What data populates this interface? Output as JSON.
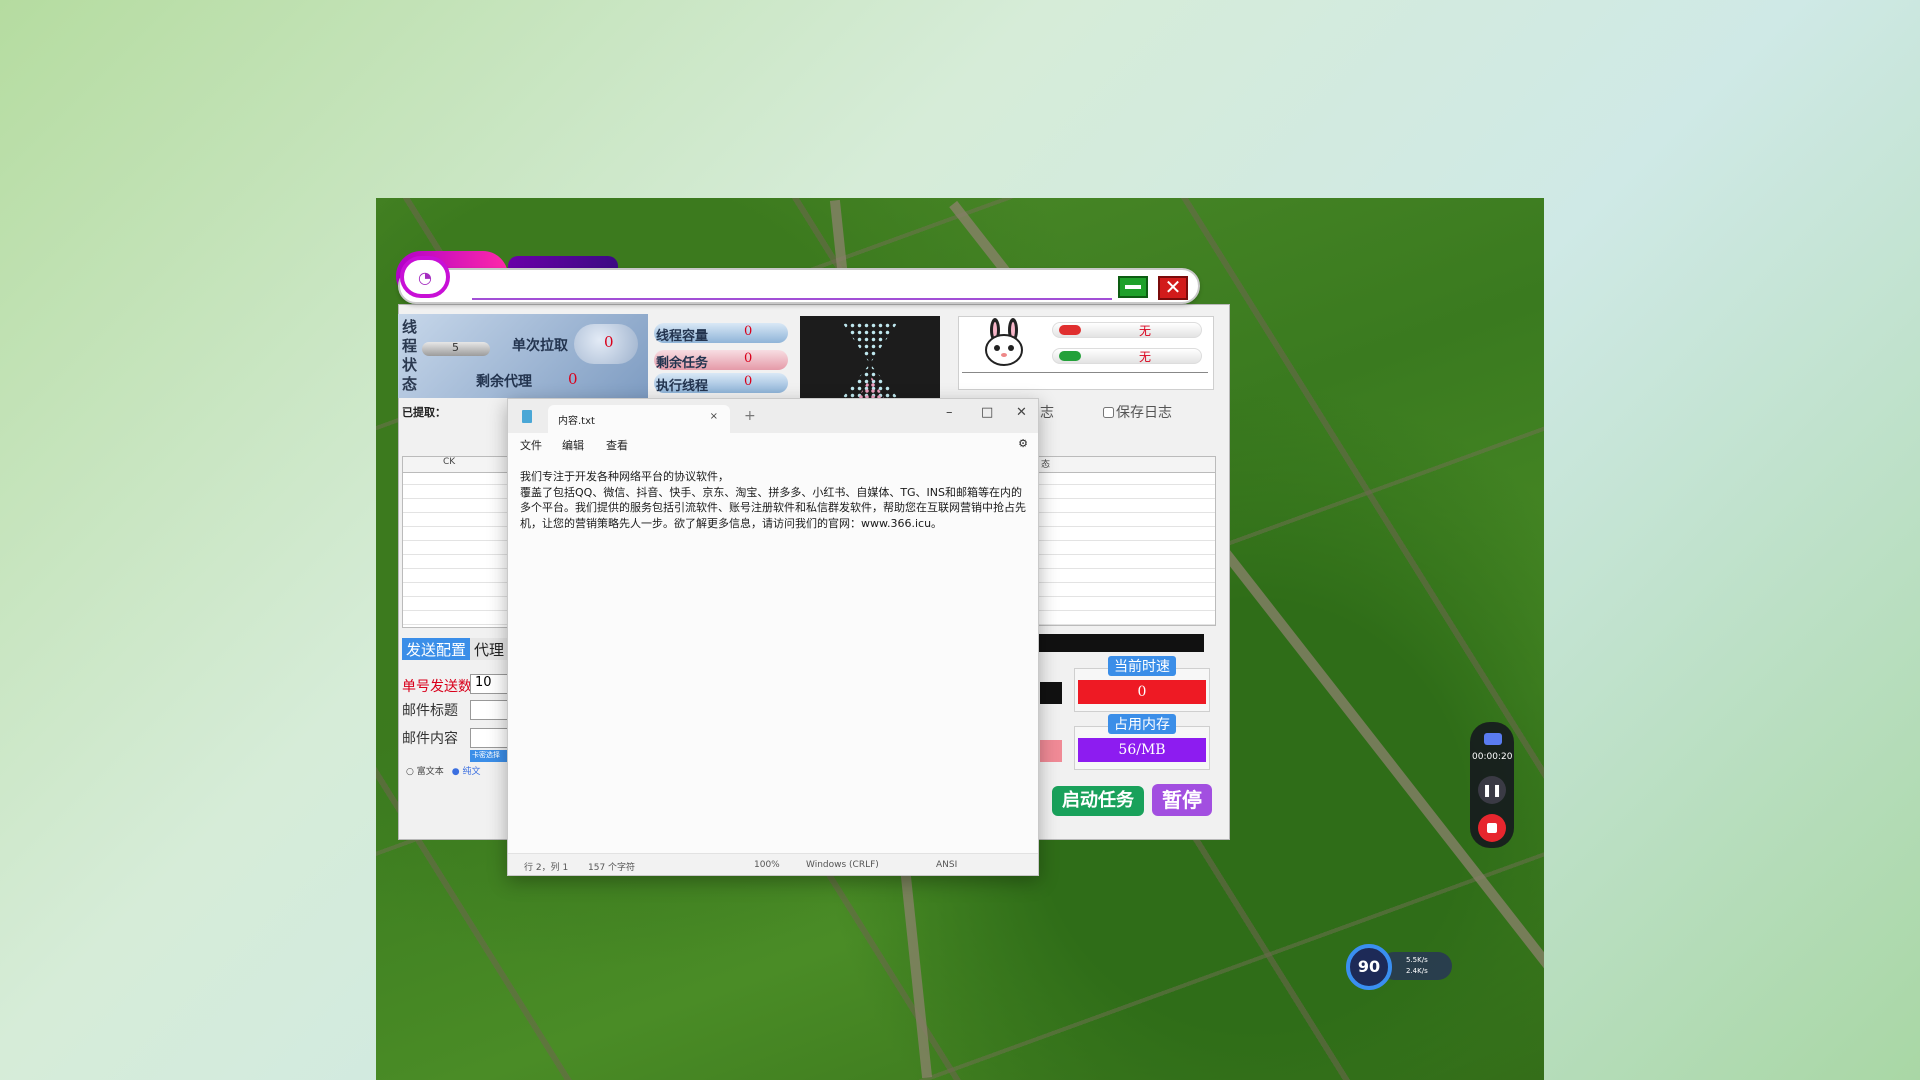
{
  "app": {
    "status_vertical": "线\n程\n状\n态",
    "slider_value": "5",
    "labels": {
      "per_send": "单次拉取",
      "remaining_proxy": "剩余代理",
      "lines_capacity": "线程容量",
      "pending_tasks": "剩余任务",
      "exec_threads": "执行线程",
      "extracted": "已提取："
    },
    "values": {
      "per_send": "0",
      "remaining_proxy": "0",
      "lines_capacity": "0",
      "pending_tasks": "0",
      "exec_threads": "0"
    },
    "info": {
      "row1": "无",
      "row2": "无"
    },
    "log_fragment": "志",
    "save_log": "保存日志",
    "grid_left_header": "CK",
    "grid_right_header": "态",
    "tabs": [
      "发送配置",
      "代理"
    ],
    "form": {
      "send_count_label": "单号发送数",
      "send_count_value": "10",
      "subject_label": "邮件标题",
      "content_label": "邮件内容",
      "small_button": "卡密选择",
      "radio1": "富文本",
      "radio2": "纯文"
    },
    "metrics": {
      "current_speed_title": "当前时速",
      "current_speed_value": "0",
      "memory_title": "占用内存",
      "memory_value": "56/MB"
    },
    "start_button": "启动任务",
    "pause_button": "暂停",
    "colors": {
      "accent_blue": "#3b8ee8",
      "speed_red": "#ee1a24",
      "memory_purple": "#8d1cf0",
      "start_green": "#19a15b",
      "pause_purple": "#a24fe0"
    }
  },
  "notepad": {
    "tab_title": "内容.txt",
    "menu": [
      "文件",
      "编辑",
      "查看"
    ],
    "content": "我们专注于开发各种网络平台的协议软件，\n覆盖了包括QQ、微信、抖音、快手、京东、淘宝、拼多多、小红书、自媒体、TG、INS和邮箱等在内的多个平台。我们提供的服务包括引流软件、账号注册软件和私信群发软件，帮助您在互联网营销中抢占先机，让您的营销策略先人一步。欲了解更多信息，请访问我们的官网：www.366.icu。",
    "status": {
      "position": "行 2，列 1",
      "chars": "157 个字符",
      "zoom": "100%",
      "line_ending": "Windows (CRLF)",
      "encoding": "ANSI"
    }
  },
  "recorder": {
    "time": "00:00:20"
  },
  "speed_widget": {
    "value": "90",
    "up": "5.5K/s",
    "down": "2.4K/s"
  }
}
